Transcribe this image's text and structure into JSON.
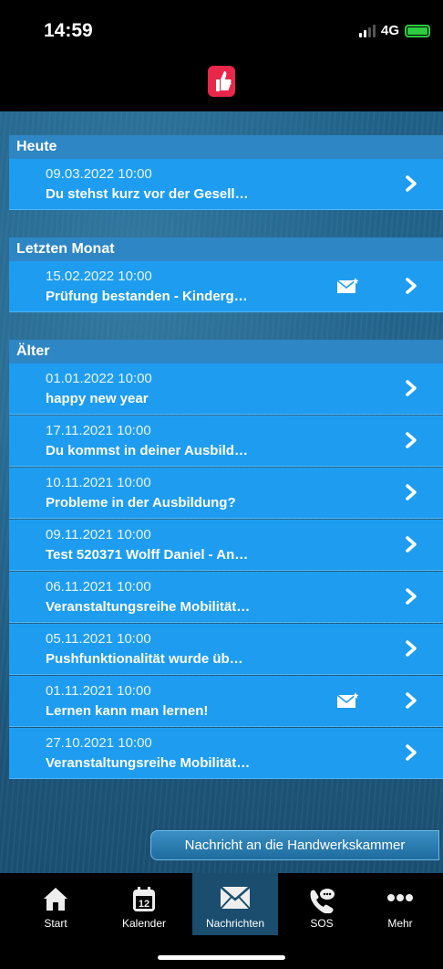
{
  "status_bar": {
    "time": "14:59",
    "network": "4G"
  },
  "sections": [
    {
      "header": "Heute",
      "items": [
        {
          "date": "09.03.2022 10:00",
          "title": "Du stehst kurz vor der Gesell…",
          "has_mail_icon": false
        }
      ]
    },
    {
      "header": "Letzten Monat",
      "items": [
        {
          "date": "15.02.2022 10:00",
          "title": "Prüfung bestanden - Kinderg…",
          "has_mail_icon": true
        }
      ]
    },
    {
      "header": "Älter",
      "items": [
        {
          "date": "01.01.2022 10:00",
          "title": "happy new year",
          "has_mail_icon": false
        },
        {
          "date": "17.11.2021 10:00",
          "title": "Du kommst in deiner Ausbild…",
          "has_mail_icon": false
        },
        {
          "date": "10.11.2021 10:00",
          "title": "Probleme in der Ausbildung?",
          "has_mail_icon": false
        },
        {
          "date": "09.11.2021 10:00",
          "title": "Test 520371 Wolff Daniel - An…",
          "has_mail_icon": false
        },
        {
          "date": "06.11.2021 10:00",
          "title": "Veranstaltungsreihe Mobilität…",
          "has_mail_icon": false
        },
        {
          "date": "05.11.2021 10:00",
          "title": "Pushfunktionalität wurde üb…",
          "has_mail_icon": false
        },
        {
          "date": "01.11.2021 10:00",
          "title": "Lernen kann man lernen!",
          "has_mail_icon": true
        },
        {
          "date": "27.10.2021 10:00",
          "title": "Veranstaltungsreihe Mobilität…",
          "has_mail_icon": false
        }
      ]
    }
  ],
  "send_button_label": "Nachricht an die Handwerkskammer",
  "tabs": [
    {
      "label": "Start",
      "icon": "home-icon",
      "active": false
    },
    {
      "label": "Kalender",
      "icon": "calendar-icon",
      "calendar_day": "12",
      "active": false
    },
    {
      "label": "Nachrichten",
      "icon": "envelope-icon",
      "active": true
    },
    {
      "label": "SOS",
      "icon": "phone-chat-icon",
      "active": false
    },
    {
      "label": "Mehr",
      "icon": "more-dots-icon",
      "active": false
    }
  ],
  "colors": {
    "row": "#1e9df0",
    "section_header": "#2e86c4",
    "logo": "#e8274b",
    "battery": "#2ecc40"
  }
}
